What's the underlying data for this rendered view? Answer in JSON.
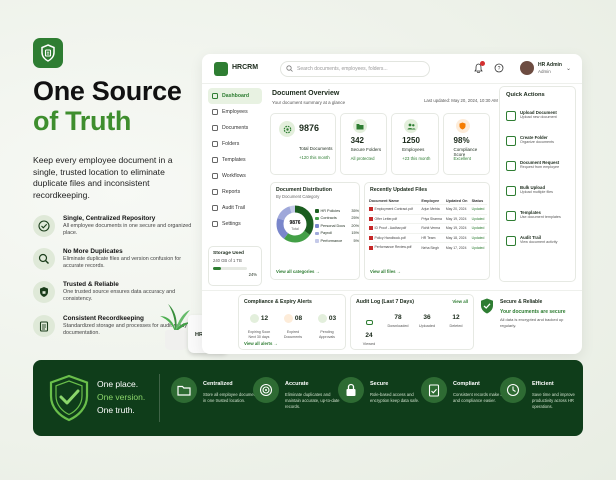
{
  "hero": {
    "title_line1": "One Source",
    "title_line2": "of Truth",
    "description": "Keep every employee document in a single, trusted location to eliminate duplicate files and inconsistent recordkeeping."
  },
  "features": [
    {
      "title": "Single, Centralized Repository",
      "desc": "All employee documents in one secure and organized place.",
      "icon": "check-circle-icon"
    },
    {
      "title": "No More Duplicates",
      "desc": "Eliminate duplicate files and version confusion for accurate records.",
      "icon": "search-icon"
    },
    {
      "title": "Trusted & Reliable",
      "desc": "One trusted source ensures data accuracy and consistency.",
      "icon": "shield-lock-icon"
    },
    {
      "title": "Consistent Recordkeeping",
      "desc": "Standardized storage and processes for audit-ready documentation.",
      "icon": "clipboard-icon"
    }
  ],
  "app": {
    "brand": "HRCRM",
    "search_placeholder": "Search documents, employees, folders...",
    "user_name": "HR Admin",
    "user_role": "Admin"
  },
  "sidebar": {
    "items": [
      {
        "label": "Dashboard",
        "active": true
      },
      {
        "label": "Employees"
      },
      {
        "label": "Documents"
      },
      {
        "label": "Folders"
      },
      {
        "label": "Templates"
      },
      {
        "label": "Workflows"
      },
      {
        "label": "Reports"
      },
      {
        "label": "Audit Trail"
      },
      {
        "label": "Settings"
      }
    ],
    "storage_label": "Storage Used",
    "storage_value": "240 GB of 1 TB",
    "storage_pct": "24%",
    "storage_fraction": 0.24
  },
  "overview": {
    "title": "Document Overview",
    "subtitle": "Your document summary at a glance",
    "updated": "Last updated: May 20, 2024, 10:30 AM",
    "stats": [
      {
        "value": "9876",
        "label": "Total Documents",
        "sub": "+120 this month"
      },
      {
        "value": "342",
        "label": "Secure Folders",
        "sub": "All protected"
      },
      {
        "value": "1250",
        "label": "Employees",
        "sub": "+23 this month"
      },
      {
        "value": "98%",
        "label": "Compliance Score",
        "sub": "Excellent"
      }
    ]
  },
  "distribution": {
    "title": "Document Distribution",
    "subtitle": "By Document Category",
    "center_value": "9876",
    "center_label": "Total",
    "link": "View all categories →",
    "categories": [
      {
        "name": "HR Policies",
        "pct": "35%",
        "color": "#1b5e20",
        "value": 35
      },
      {
        "name": "Contracts",
        "pct": "25%",
        "color": "#43a047",
        "value": 25
      },
      {
        "name": "Personal Docs",
        "pct": "20%",
        "color": "#7986cb",
        "value": 20
      },
      {
        "name": "Payroll",
        "pct": "15%",
        "color": "#9fa8da",
        "value": 15
      },
      {
        "name": "Performance",
        "pct": "5%",
        "color": "#c5cae9",
        "value": 5
      }
    ]
  },
  "recent": {
    "title": "Recently Updated Files",
    "headers": [
      "Document Name",
      "Employee",
      "Updated On",
      "Status"
    ],
    "rows": [
      [
        "Employment Contract.pdf",
        "Arjun Mehta",
        "May 20, 2024",
        "Updated"
      ],
      [
        "Offer Letter.pdf",
        "Priya Sharma",
        "May 19, 2024",
        "Updated"
      ],
      [
        "ID Proof - Aadhar.pdf",
        "Rohit Verma",
        "May 19, 2024",
        "Updated"
      ],
      [
        "Policy Handbook.pdf",
        "HR Team",
        "May 18, 2024",
        "Updated"
      ],
      [
        "Performance Review.pdf",
        "Neha Singh",
        "May 17, 2024",
        "Updated"
      ]
    ],
    "link": "View all files →"
  },
  "quick_actions": {
    "title": "Quick Actions",
    "items": [
      {
        "name": "Upload Document",
        "desc": "Upload new document"
      },
      {
        "name": "Create Folder",
        "desc": "Organize documents"
      },
      {
        "name": "Document Request",
        "desc": "Request from employee"
      },
      {
        "name": "Bulk Upload",
        "desc": "Upload multiple files"
      },
      {
        "name": "Templates",
        "desc": "Use document templates"
      },
      {
        "name": "Audit Trail",
        "desc": "View document activity"
      }
    ]
  },
  "compliance": {
    "title": "Compliance & Expiry Alerts",
    "items": [
      {
        "value": "12",
        "label": "Expiring Soon",
        "sub": "Next 30 days"
      },
      {
        "value": "08",
        "label": "Expired",
        "sub": "Documents"
      },
      {
        "value": "03",
        "label": "Pending",
        "sub": "Approvals"
      }
    ],
    "link": "View all alerts →"
  },
  "audit": {
    "title": "Audit Log (Last 7 Days)",
    "link": "View all",
    "items": [
      {
        "value": "24",
        "label": "Viewed"
      },
      {
        "value": "78",
        "label": "Downloaded"
      },
      {
        "value": "36",
        "label": "Uploaded"
      },
      {
        "value": "12",
        "label": "Deleted"
      }
    ]
  },
  "secure": {
    "title": "Secure & Reliable",
    "status": "Your documents are secure",
    "desc": "All data is encrypted and backed up regularly."
  },
  "mug": {
    "label": "HRCRM"
  },
  "banner": {
    "line1": "One place.",
    "line2": "One version.",
    "line3": "One truth.",
    "items": [
      {
        "title": "Centralized",
        "desc": "Store all employee documents in one trusted location."
      },
      {
        "title": "Accurate",
        "desc": "Eliminate duplicates and maintain accurate, up-to-date records."
      },
      {
        "title": "Secure",
        "desc": "Role-based access and encryption keep data safe."
      },
      {
        "title": "Compliant",
        "desc": "Consistent records make audits and compliance easier."
      },
      {
        "title": "Efficient",
        "desc": "Save time and improve productivity across HR operations."
      }
    ]
  }
}
